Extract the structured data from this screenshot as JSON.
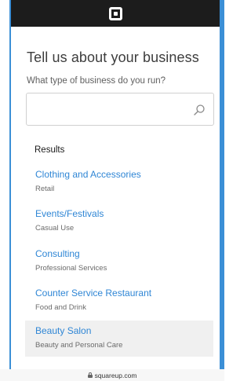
{
  "header": {
    "logo": "square-logo-icon"
  },
  "page": {
    "title": "Tell us about your business",
    "question": "What type of business do you run?"
  },
  "search": {
    "value": "",
    "placeholder": "",
    "icon": "search-icon"
  },
  "results": {
    "heading": "Results",
    "items": [
      {
        "name": "Clothing and Accessories",
        "category": "Retail"
      },
      {
        "name": "Events/Festivals",
        "category": "Casual Use"
      },
      {
        "name": "Consulting",
        "category": "Professional Services"
      },
      {
        "name": "Counter Service Restaurant",
        "category": "Food and Drink"
      },
      {
        "name": "Beauty Salon",
        "category": "Beauty and Personal Care"
      }
    ]
  },
  "browser": {
    "url": "squareup.com"
  },
  "colors": {
    "link": "#2f86d5",
    "header": "#1c1c1c",
    "accent_rail": "#3b8fd6",
    "highlight": "#f0f0f0"
  }
}
